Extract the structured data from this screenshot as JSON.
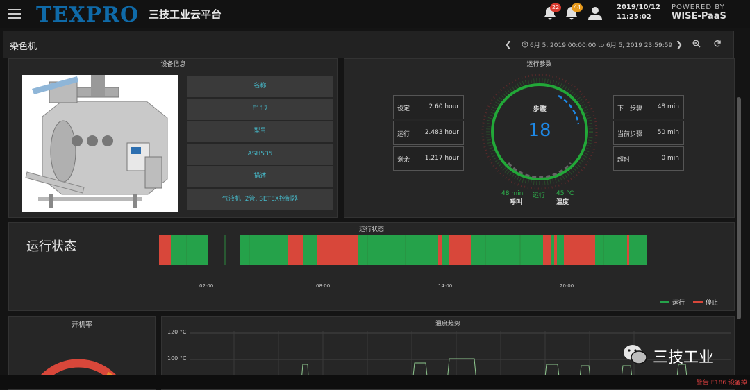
{
  "header": {
    "logo_text": "TEXPRO",
    "app_title": "三技工业云平台",
    "notif_count_1": "22",
    "notif_count_2": "44",
    "date": "2019/10/12",
    "time": "11:25:02",
    "powered_by": "POWERED BY",
    "brand": "WISE-PaaS",
    "badge_color_1": "#d83a2e",
    "badge_color_2": "#e89a1c"
  },
  "subbar": {
    "title": "染色机",
    "time_range": "6月 5, 2019 00:00:00 to 6月 5, 2019 23:59:59"
  },
  "device_info": {
    "title": "设备信息",
    "items": [
      "名称",
      "F117",
      "型号",
      "ASH535",
      "描述",
      "气液机, 2管, SETEX控制器"
    ]
  },
  "params": {
    "title": "运行参数",
    "left_cards": [
      {
        "label": "设定",
        "value": "2.60 hour"
      },
      {
        "label": "运行",
        "value": "2.483 hour"
      },
      {
        "label": "剩余",
        "value": "1.217 hour"
      }
    ],
    "right_cards": [
      {
        "label": "下一步骤",
        "value": "48 min"
      },
      {
        "label": "当前步骤",
        "value": "50 min"
      },
      {
        "label": "超时",
        "value": "0 min"
      }
    ],
    "gauge_title": "步骤",
    "gauge_value": "18",
    "status_val_1": "48 min",
    "status_val_2": "运行",
    "status_val_3": "45 °C",
    "status_lbl_1": "呼叫",
    "status_lbl_3": "温度",
    "ring_color": "#22a838",
    "value_color": "#1e88e5"
  },
  "status": {
    "title": "运行状态",
    "big_label": "运行状态",
    "ticks": [
      "02:00",
      "08:00",
      "14:00",
      "20:00"
    ],
    "legend_run": "运行",
    "legend_stop": "停止",
    "run_color": "#25a24a",
    "stop_color": "#d8473a"
  },
  "uptime": {
    "title": "开机率"
  },
  "temp": {
    "title": "温度趋势",
    "y_ticks": [
      "120 °C",
      "100 °C"
    ]
  },
  "footer": {
    "alarm": "警告 F186 设备掉"
  },
  "watermark": {
    "text": "三技工业"
  }
}
